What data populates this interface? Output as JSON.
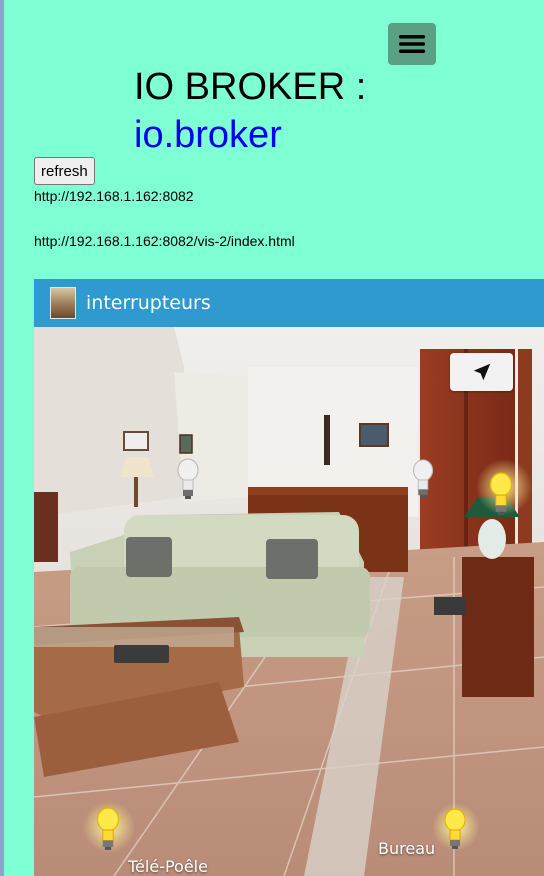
{
  "header": {
    "title": "IO BROKER :",
    "subtitle": "io.broker",
    "menu_icon": "hamburger-icon"
  },
  "actions": {
    "refresh_label": "refresh"
  },
  "links": {
    "url1": "http://192.168.1.162:8082",
    "url2": "http://192.168.1.162:8082/vis-2/index.html"
  },
  "panel": {
    "title": "interrupteurs",
    "locate_icon": "navigation-arrow-icon",
    "labels": {
      "tele_poele": "Télé-Poêle",
      "bureau": "Bureau"
    }
  },
  "colors": {
    "background": "#7fffd4",
    "header_bar": "#2e9ad0",
    "link": "#0000ee",
    "bulb_on": "#ffe94a",
    "bulb_off": "#e8e8e8"
  }
}
